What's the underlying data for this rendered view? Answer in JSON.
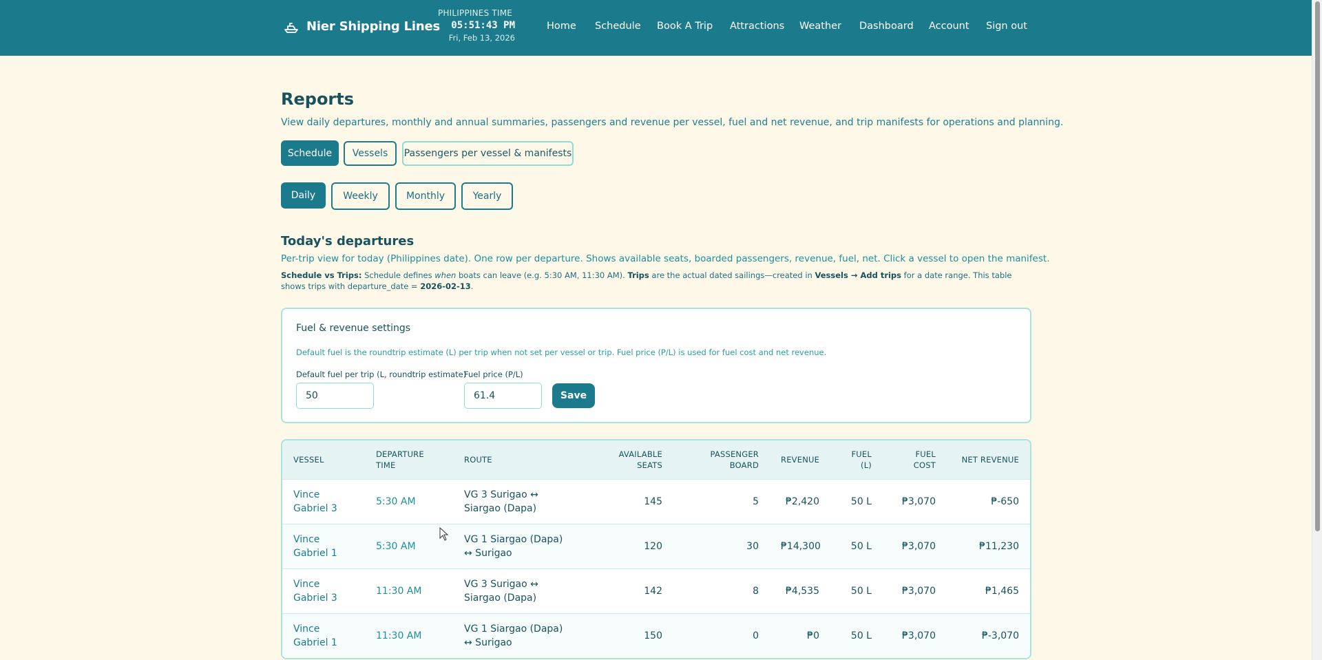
{
  "app": {
    "brand": "Nier Shipping Lines",
    "clock": {
      "zone": "PHILIPPINES TIME",
      "time": "05:51:43 PM",
      "date": "Fri, Feb 13, 2026"
    },
    "nav": [
      "Home",
      "Schedule",
      "Book A Trip",
      "Attractions",
      "Weather",
      "Dashboard",
      "Account",
      "Sign out"
    ]
  },
  "page": {
    "title": "Reports",
    "subtitle": "View daily departures, monthly and annual summaries, passengers and revenue per vessel, fuel and net revenue, and trip manifests for operations and planning.",
    "tabs": [
      "Schedule",
      "Vessels",
      "Passengers per vessel & manifests"
    ],
    "active_tab": "Schedule",
    "periods": [
      "Daily",
      "Weekly",
      "Monthly",
      "Yearly"
    ],
    "active_period": "Daily"
  },
  "section": {
    "title": "Today's departures",
    "desc": "Per-trip view for today (Philippines date). One row per departure. Shows available seats, boarded passengers, revenue, fuel, net. Click a vessel to open the manifest.",
    "note": {
      "label1": "Schedule vs Trips:",
      "text1": " Schedule defines ",
      "em": "when",
      "text2": " boats can leave (e.g. 5:30 AM, 11:30 AM). ",
      "label2": "Trips",
      "text3": " are the actual dated sailings—created in ",
      "label3": "Vessels → Add trips",
      "text4": " for a date range. This table shows trips with departure_date = ",
      "date": "2026-02-13",
      "end": "."
    }
  },
  "settings": {
    "title": "Fuel & revenue settings",
    "desc": "Default fuel is the roundtrip estimate (L) per trip when not set per vessel or trip. Fuel price (P/L) is used for fuel cost and net revenue.",
    "fuel_label": "Default fuel per trip (L, roundtrip estimate)",
    "fuel_value": "50",
    "price_label": "Fuel price (P/L)",
    "price_value": "61.4",
    "save_label": "Save"
  },
  "table": {
    "headers": [
      "VESSEL",
      "DEPARTURE TIME",
      "ROUTE",
      "AVAILABLE SEATS",
      "PASSENGER BOARD",
      "REVENUE",
      "FUEL (L)",
      "FUEL COST",
      "NET REVENUE"
    ],
    "rows": [
      {
        "vessel": "Vince Gabriel 3",
        "time": "5:30 AM",
        "route": "VG 3 Surigao ↔ Siargao (Dapa)",
        "seats": "145",
        "board": "5",
        "revenue": "₱2,420",
        "fuel": "50 L",
        "fuel_cost": "₱3,070",
        "net": "₱-650"
      },
      {
        "vessel": "Vince Gabriel 1",
        "time": "5:30 AM",
        "route": "VG 1 Siargao (Dapa) ↔ Surigao",
        "seats": "120",
        "board": "30",
        "revenue": "₱14,300",
        "fuel": "50 L",
        "fuel_cost": "₱3,070",
        "net": "₱11,230"
      },
      {
        "vessel": "Vince Gabriel 3",
        "time": "11:30 AM",
        "route": "VG 3 Surigao ↔ Siargao (Dapa)",
        "seats": "142",
        "board": "8",
        "revenue": "₱4,535",
        "fuel": "50 L",
        "fuel_cost": "₱3,070",
        "net": "₱1,465"
      },
      {
        "vessel": "Vince Gabriel 1",
        "time": "11:30 AM",
        "route": "VG 1 Siargao (Dapa) ↔ Surigao",
        "seats": "150",
        "board": "0",
        "revenue": "₱0",
        "fuel": "50 L",
        "fuel_cost": "₱3,070",
        "net": "₱-3,070"
      }
    ]
  },
  "icons": {
    "brand": "ship-icon"
  }
}
